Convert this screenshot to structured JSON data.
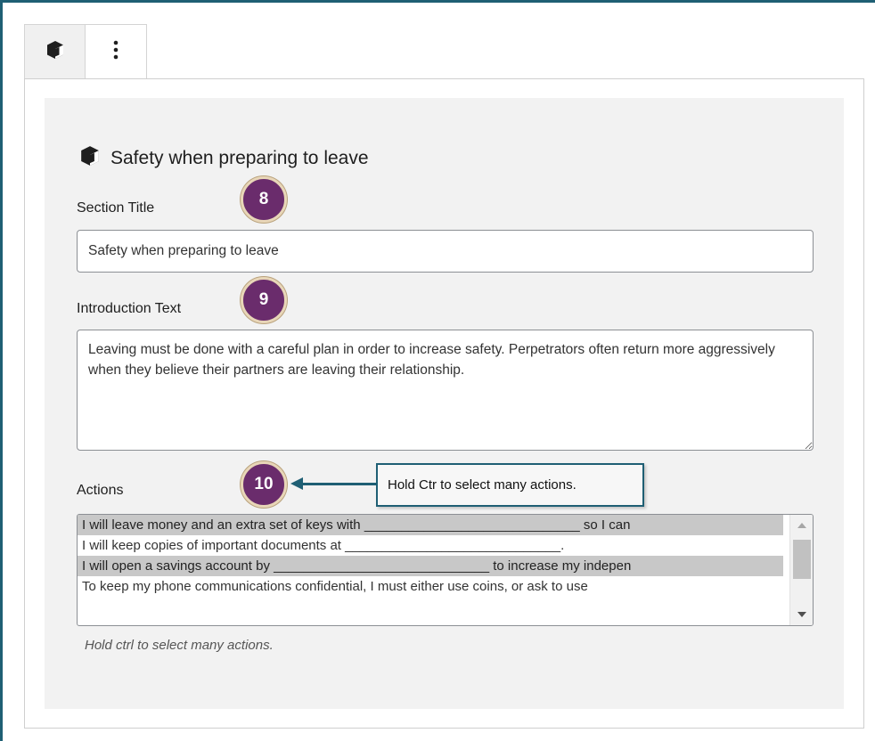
{
  "toolbar": {
    "block_icon": "cube-icon",
    "more_icon": "vertical-ellipsis-icon"
  },
  "block": {
    "icon": "cube-icon",
    "title": "Safety when preparing to leave"
  },
  "fields": {
    "section_title_label": "Section Title",
    "section_title_value": "Safety when preparing to leave",
    "intro_label": "Introduction Text",
    "intro_value": "Leaving must be done with a careful plan in order to increase safety. Perpetrators often return more aggressively when they believe their partners are leaving their relationship.",
    "actions_label": "Actions",
    "actions_options": [
      {
        "text": "I will leave money and an extra set of keys with _____________________________ so I can",
        "selected": true
      },
      {
        "text": "I will keep copies of important documents at _____________________________.",
        "selected": false
      },
      {
        "text": "I will open a savings account by _____________________________ to increase my indepen",
        "selected": true
      },
      {
        "text": "To keep my phone communications confidential, I must either use coins, or ask to use",
        "selected": false
      }
    ],
    "actions_help": "Hold ctrl to select many actions."
  },
  "callouts": {
    "c8": "8",
    "c9": "9",
    "c10": "10",
    "tooltip": "Hold Ctr to select many actions."
  },
  "colors": {
    "frame": "#1f5f74",
    "callout_fill": "#6a2c6c",
    "selected_option": "#c8c8c8"
  }
}
